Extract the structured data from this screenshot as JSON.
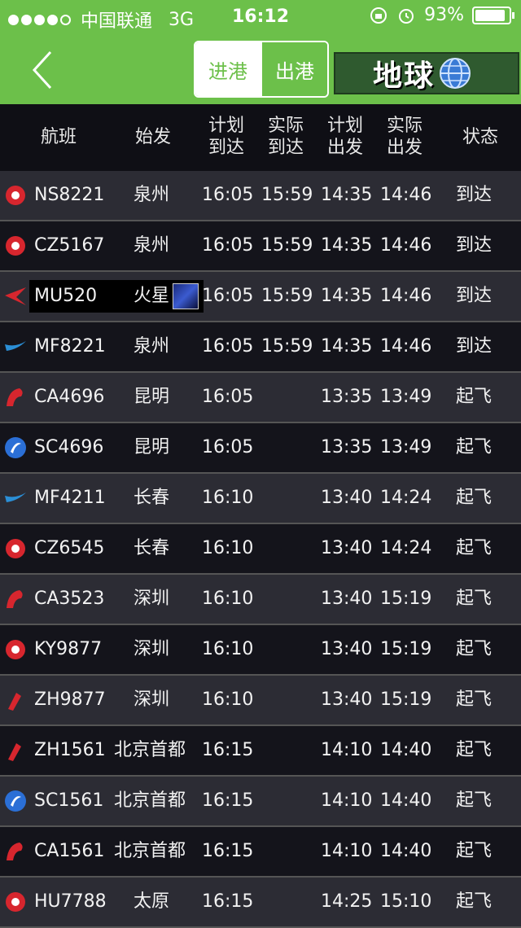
{
  "status": {
    "carrier": "中国联通",
    "network": "3G",
    "time": "16:12",
    "battery": "93%"
  },
  "nav": {
    "tab_arrivals": "进港",
    "tab_departures": "出港",
    "earth_label": "地球"
  },
  "headers": {
    "flight": "航班",
    "origin": "始发",
    "sched_arr_1": "计划",
    "sched_arr_2": "到达",
    "act_arr_1": "实际",
    "act_arr_2": "到达",
    "sched_dep_1": "计划",
    "sched_dep_2": "出发",
    "act_dep_1": "实际",
    "act_dep_2": "出发",
    "status": "状态"
  },
  "flights": [
    {
      "flight": "NS8221",
      "origin": "泉州",
      "sched_arr": "16:05",
      "act_arr": "15:59",
      "sched_dep": "14:35",
      "act_dep": "14:46",
      "status": "到达",
      "logo": "hebei-airlines-logo",
      "logo_color": "#d7262e"
    },
    {
      "flight": "CZ5167",
      "origin": "泉州",
      "sched_arr": "16:05",
      "act_arr": "15:59",
      "sched_dep": "14:35",
      "act_dep": "14:46",
      "status": "到达",
      "logo": "china-southern-logo",
      "logo_color": "#d7262e"
    },
    {
      "flight": "MU520",
      "origin": "火星",
      "sched_arr": "16:05",
      "act_arr": "15:59",
      "sched_dep": "14:35",
      "act_dep": "14:46",
      "status": "到达",
      "logo": "china-eastern-logo",
      "logo_color": "#d7262e"
    },
    {
      "flight": "MF8221",
      "origin": "泉州",
      "sched_arr": "16:05",
      "act_arr": "15:59",
      "sched_dep": "14:35",
      "act_dep": "14:46",
      "status": "到达",
      "logo": "xiamen-airlines-logo",
      "logo_color": "#2b8fd6"
    },
    {
      "flight": "CA4696",
      "origin": "昆明",
      "sched_arr": "16:05",
      "act_arr": "",
      "sched_dep": "13:35",
      "act_dep": "13:49",
      "status": "起飞",
      "logo": "air-china-logo",
      "logo_color": "#d7262e"
    },
    {
      "flight": "SC4696",
      "origin": "昆明",
      "sched_arr": "16:05",
      "act_arr": "",
      "sched_dep": "13:35",
      "act_dep": "13:49",
      "status": "起飞",
      "logo": "shandong-airlines-logo",
      "logo_color": "#2b6fd6"
    },
    {
      "flight": "MF4211",
      "origin": "长春",
      "sched_arr": "16:10",
      "act_arr": "",
      "sched_dep": "13:40",
      "act_dep": "14:24",
      "status": "起飞",
      "logo": "xiamen-airlines-logo",
      "logo_color": "#2b8fd6"
    },
    {
      "flight": "CZ6545",
      "origin": "长春",
      "sched_arr": "16:10",
      "act_arr": "",
      "sched_dep": "13:40",
      "act_dep": "14:24",
      "status": "起飞",
      "logo": "china-southern-logo",
      "logo_color": "#d7262e"
    },
    {
      "flight": "CA3523",
      "origin": "深圳",
      "sched_arr": "16:10",
      "act_arr": "",
      "sched_dep": "13:40",
      "act_dep": "15:19",
      "status": "起飞",
      "logo": "air-china-logo",
      "logo_color": "#d7262e"
    },
    {
      "flight": "KY9877",
      "origin": "深圳",
      "sched_arr": "16:10",
      "act_arr": "",
      "sched_dep": "13:40",
      "act_dep": "15:19",
      "status": "起飞",
      "logo": "kunming-airlines-logo",
      "logo_color": "#d7262e"
    },
    {
      "flight": "ZH9877",
      "origin": "深圳",
      "sched_arr": "16:10",
      "act_arr": "",
      "sched_dep": "13:40",
      "act_dep": "15:19",
      "status": "起飞",
      "logo": "shenzhen-airlines-logo",
      "logo_color": "#d7262e"
    },
    {
      "flight": "ZH1561",
      "origin": "北京首都",
      "sched_arr": "16:15",
      "act_arr": "",
      "sched_dep": "14:10",
      "act_dep": "14:40",
      "status": "起飞",
      "logo": "shenzhen-airlines-logo",
      "logo_color": "#d7262e"
    },
    {
      "flight": "SC1561",
      "origin": "北京首都",
      "sched_arr": "16:15",
      "act_arr": "",
      "sched_dep": "14:10",
      "act_dep": "14:40",
      "status": "起飞",
      "logo": "shandong-airlines-logo",
      "logo_color": "#2b6fd6"
    },
    {
      "flight": "CA1561",
      "origin": "北京首都",
      "sched_arr": "16:15",
      "act_arr": "",
      "sched_dep": "14:10",
      "act_dep": "14:40",
      "status": "起飞",
      "logo": "air-china-logo",
      "logo_color": "#d7262e"
    },
    {
      "flight": "HU7788",
      "origin": "太原",
      "sched_arr": "16:15",
      "act_arr": "",
      "sched_dep": "14:25",
      "act_dep": "15:10",
      "status": "起飞",
      "logo": "hainan-airlines-logo",
      "logo_color": "#d7262e"
    }
  ],
  "colors": {
    "accent_green": "#6cc04a",
    "row_light": "#2c2c34",
    "row_dark": "#14141b"
  }
}
